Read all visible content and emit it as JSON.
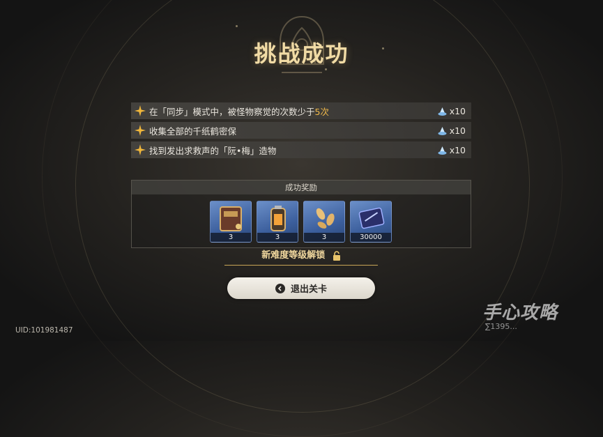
{
  "title": "挑战成功",
  "goals": [
    {
      "text_pre": "在「同步」模式中，被怪物察觉的次数少于",
      "highlight": "5次",
      "reward_icon": "crystal-icon",
      "reward_qty": "x10"
    },
    {
      "text_pre": "收集全部的千纸鹤密保",
      "highlight": "",
      "reward_icon": "crystal-icon",
      "reward_qty": "x10"
    },
    {
      "text_pre": "找到发出求救声的「阮•梅」造物",
      "highlight": "",
      "reward_icon": "crystal-icon",
      "reward_qty": "x10"
    }
  ],
  "rewards": {
    "header": "成功奖励",
    "items": [
      {
        "icon": "book-icon",
        "qty": "3"
      },
      {
        "icon": "battery-icon",
        "qty": "3"
      },
      {
        "icon": "seeds-icon",
        "qty": "3"
      },
      {
        "icon": "card-icon",
        "qty": "30000"
      }
    ]
  },
  "unlock_text": "新难度等级解锁",
  "exit_button": "退出关卡",
  "uid": "UID:101981487",
  "watermark": {
    "main": "手心攻略",
    "sub": "∑1395..."
  },
  "colors": {
    "title": "#f1dba5",
    "highlight": "#f0b94a",
    "accent_gold": "#c9a656"
  }
}
